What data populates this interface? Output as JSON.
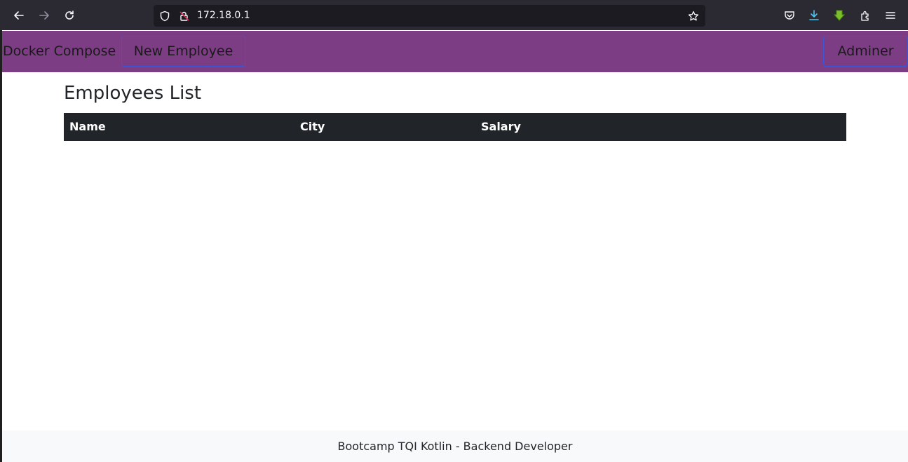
{
  "browser": {
    "url": "172.18.0.1",
    "icons": {
      "back": "arrow-left-icon",
      "forward": "arrow-right-icon",
      "reload": "reload-icon",
      "shield": "shield-icon",
      "lock": "insecure-lock-icon",
      "star": "bookmark-star-icon",
      "pocket": "pocket-icon",
      "download": "download-icon",
      "extension": "extension-green-icon",
      "puzzle": "puzzle-icon",
      "menu": "hamburger-menu-icon"
    }
  },
  "navbar": {
    "brand": "Docker Compose",
    "links": [
      {
        "label": "New Employee"
      },
      {
        "label": "Adminer"
      }
    ],
    "color": "#7c3d84"
  },
  "main": {
    "title": "Employees List",
    "table": {
      "columns": [
        "Name",
        "City",
        "Salary"
      ],
      "rows": []
    }
  },
  "footer": {
    "text": "Bootcamp TQI Kotlin - Backend Developer"
  }
}
